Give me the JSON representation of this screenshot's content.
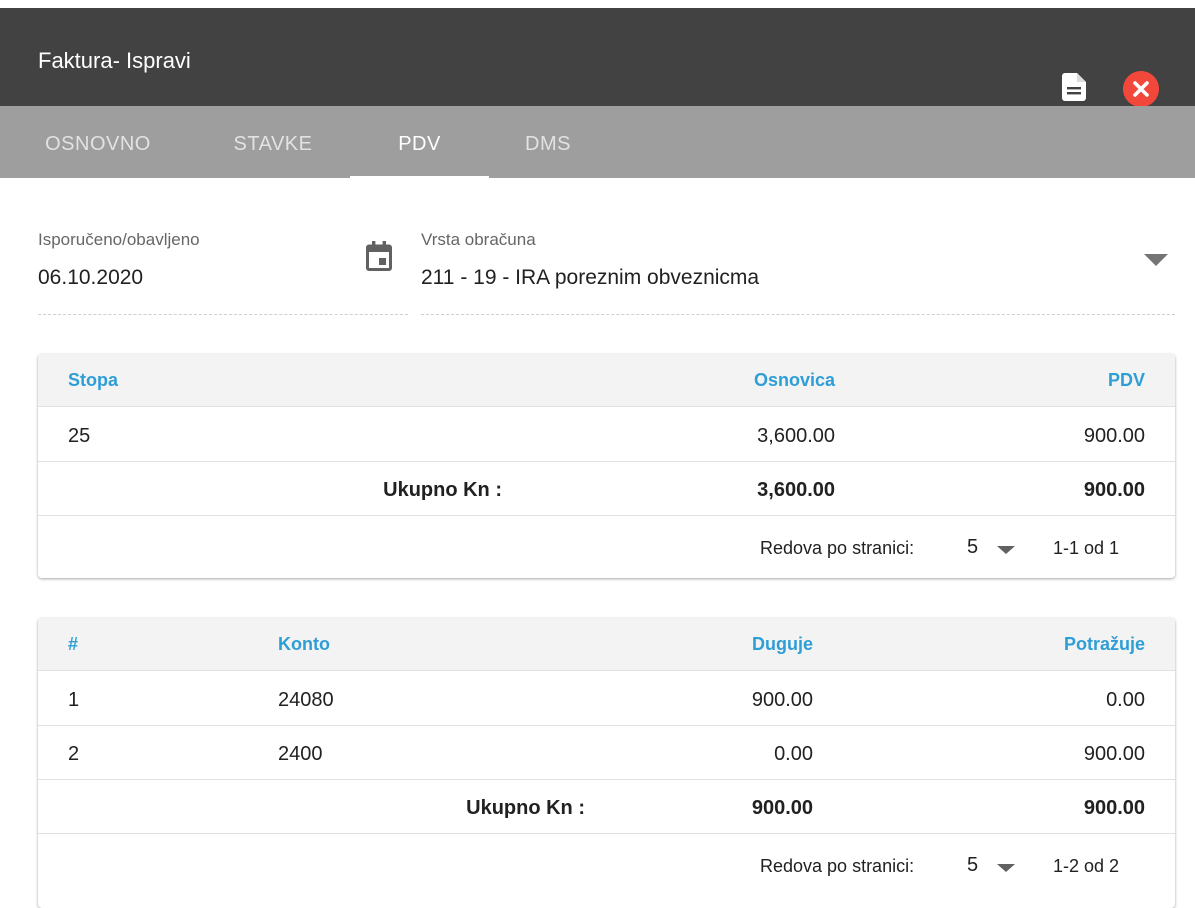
{
  "window": {
    "title": "Faktura- Ispravi",
    "document_icon": "document-icon",
    "close_icon": "close-icon",
    "close_color": "#f2483b"
  },
  "tabs": [
    {
      "label": "OSNOVNO",
      "active": false
    },
    {
      "label": "STAVKE",
      "active": false
    },
    {
      "label": "PDV",
      "active": true
    },
    {
      "label": "DMS",
      "active": false
    }
  ],
  "fields": {
    "delivered": {
      "label": "Isporučeno/obavljeno",
      "value": "06.10.2020",
      "icon": "calendar-icon"
    },
    "calc_type": {
      "label": "Vrsta obračuna",
      "value": "211 - 19 - IRA poreznim obveznicma",
      "icon": "dropdown-caret-icon"
    }
  },
  "vat_table": {
    "headers": {
      "stopa": "Stopa",
      "osnovica": "Osnovica",
      "pdv": "PDV"
    },
    "rows": [
      {
        "stopa": "25",
        "osnovica": "3,600.00",
        "pdv": "900.00"
      }
    ],
    "total": {
      "label": "Ukupno Kn :",
      "osnovica": "3,600.00",
      "pdv": "900.00"
    },
    "pager": {
      "label": "Redova po stranici:",
      "per_page": "5",
      "range": "1-1 od 1"
    }
  },
  "ledger_table": {
    "headers": {
      "num": "#",
      "konto": "Konto",
      "duguje": "Duguje",
      "potrazuje": "Potražuje"
    },
    "rows": [
      {
        "num": "1",
        "konto": "24080",
        "duguje": "900.00",
        "potrazuje": "0.00"
      },
      {
        "num": "2",
        "konto": "2400",
        "duguje": "0.00",
        "potrazuje": "900.00"
      }
    ],
    "total": {
      "label": "Ukupno Kn :",
      "duguje": "900.00",
      "potrazuje": "900.00"
    },
    "pager": {
      "label": "Redova po stranici:",
      "per_page": "5",
      "range": "1-2 od 2"
    }
  },
  "colors": {
    "header_bg": "#424242",
    "tabbar_bg": "#9e9e9e",
    "column_header": "#2e9ed6"
  }
}
